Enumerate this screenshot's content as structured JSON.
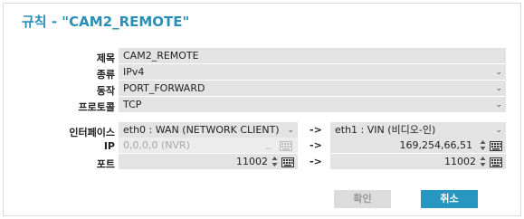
{
  "dialog": {
    "title": "규칙 - \"CAM2_REMOTE\""
  },
  "rule": {
    "name_label": "제목",
    "name_value": "CAM2_REMOTE",
    "type_label": "종류",
    "type_value": "IPv4",
    "action_label": "동작",
    "action_value": "PORT_FORWARD",
    "protocol_label": "프로토콜",
    "protocol_value": "TCP"
  },
  "mapping": {
    "interface_label": "인터페이스",
    "ip_label": "IP",
    "port_label": "포트",
    "arrow": "->",
    "source": {
      "interface": "eth0 : WAN (NETWORK CLIENT)",
      "ip": "0,0,0,0 (NVR)",
      "port": "11002"
    },
    "dest": {
      "interface": "eth1 : VIN (비디오-인)",
      "ip": "169,254,66,51",
      "port": "11002"
    }
  },
  "buttons": {
    "ok_label": "확인",
    "cancel_label": "취소"
  },
  "colors": {
    "title": "#2a8fb8",
    "primary_button": "#2796c0",
    "field_bg": "#e3e3e3"
  }
}
